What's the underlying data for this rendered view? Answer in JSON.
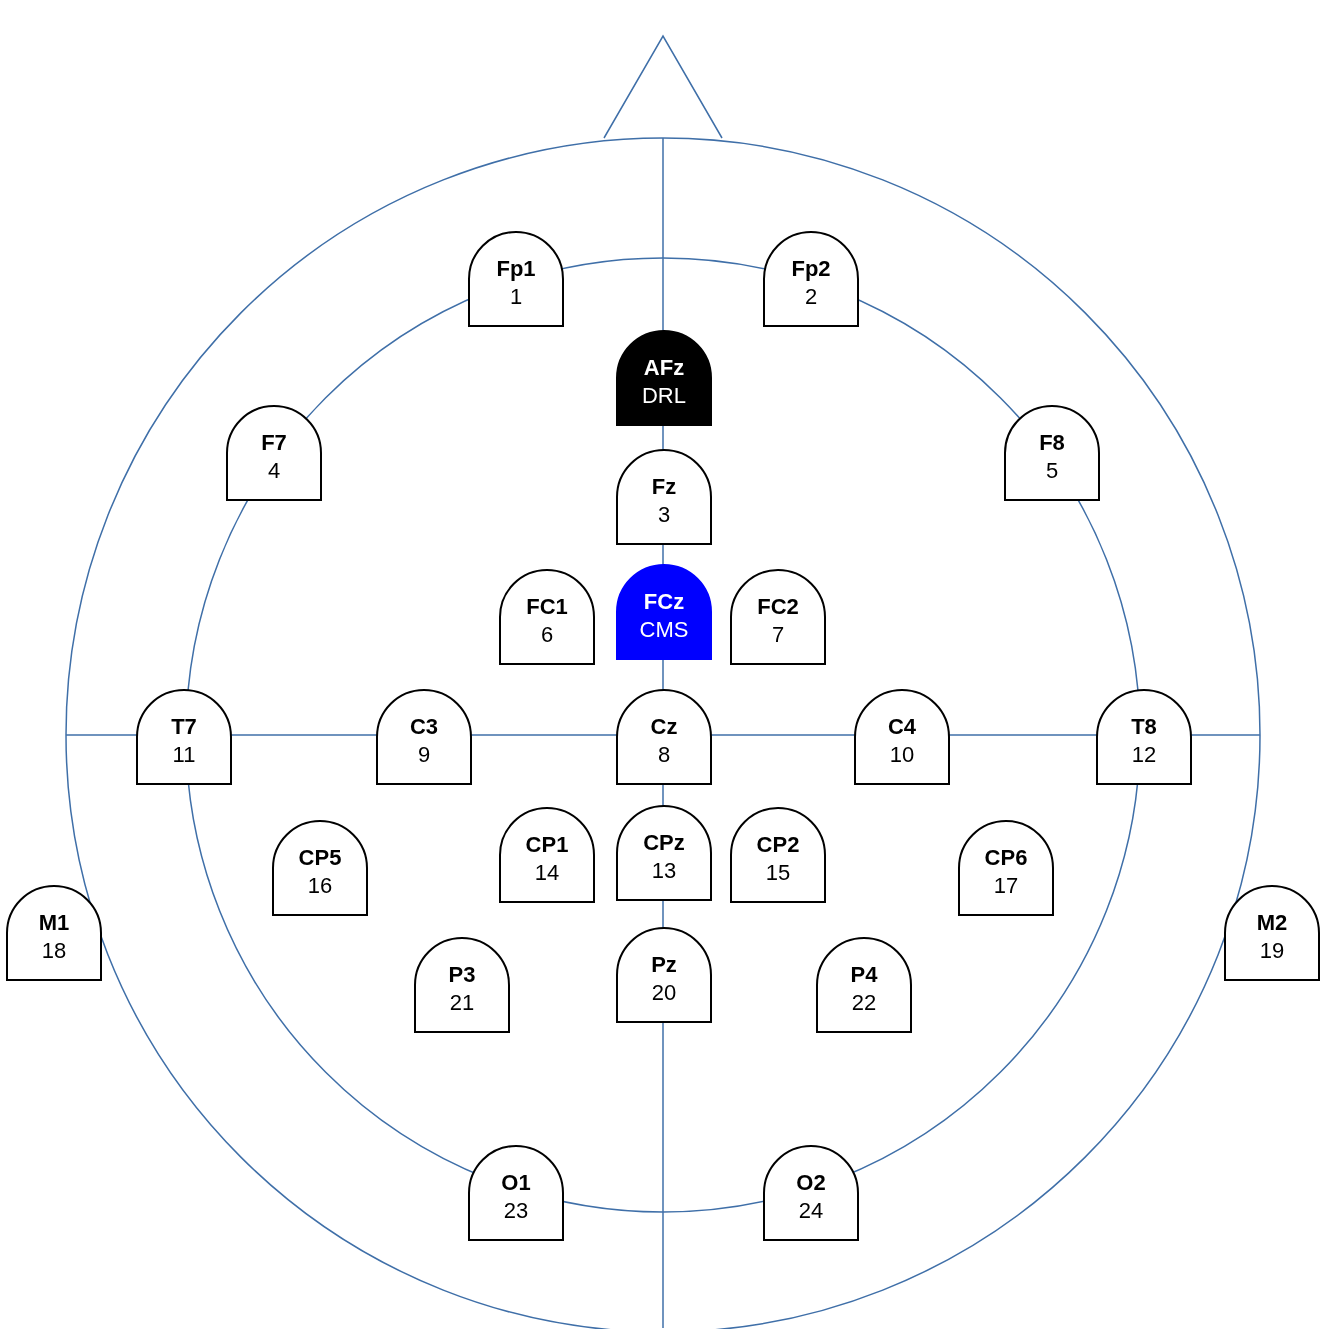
{
  "electrodes": [
    {
      "name": "Fp1",
      "label": "1",
      "kind": "electrode"
    },
    {
      "name": "Fp2",
      "label": "2",
      "kind": "electrode"
    },
    {
      "name": "AFz",
      "label": "DRL",
      "kind": "ground"
    },
    {
      "name": "F7",
      "label": "4",
      "kind": "electrode"
    },
    {
      "name": "F8",
      "label": "5",
      "kind": "electrode"
    },
    {
      "name": "Fz",
      "label": "3",
      "kind": "electrode"
    },
    {
      "name": "FC1",
      "label": "6",
      "kind": "electrode"
    },
    {
      "name": "FCz",
      "label": "CMS",
      "kind": "reference"
    },
    {
      "name": "FC2",
      "label": "7",
      "kind": "electrode"
    },
    {
      "name": "T7",
      "label": "11",
      "kind": "electrode"
    },
    {
      "name": "C3",
      "label": "9",
      "kind": "electrode"
    },
    {
      "name": "Cz",
      "label": "8",
      "kind": "electrode"
    },
    {
      "name": "C4",
      "label": "10",
      "kind": "electrode"
    },
    {
      "name": "T8",
      "label": "12",
      "kind": "electrode"
    },
    {
      "name": "CP5",
      "label": "16",
      "kind": "electrode"
    },
    {
      "name": "CP1",
      "label": "14",
      "kind": "electrode"
    },
    {
      "name": "CPz",
      "label": "13",
      "kind": "electrode"
    },
    {
      "name": "CP2",
      "label": "15",
      "kind": "electrode"
    },
    {
      "name": "CP6",
      "label": "17",
      "kind": "electrode"
    },
    {
      "name": "M1",
      "label": "18",
      "kind": "electrode"
    },
    {
      "name": "M2",
      "label": "19",
      "kind": "electrode"
    },
    {
      "name": "P3",
      "label": "21",
      "kind": "electrode"
    },
    {
      "name": "Pz",
      "label": "20",
      "kind": "electrode"
    },
    {
      "name": "P4",
      "label": "22",
      "kind": "electrode"
    },
    {
      "name": "O1",
      "label": "23",
      "kind": "electrode"
    },
    {
      "name": "O2",
      "label": "24",
      "kind": "electrode"
    }
  ]
}
